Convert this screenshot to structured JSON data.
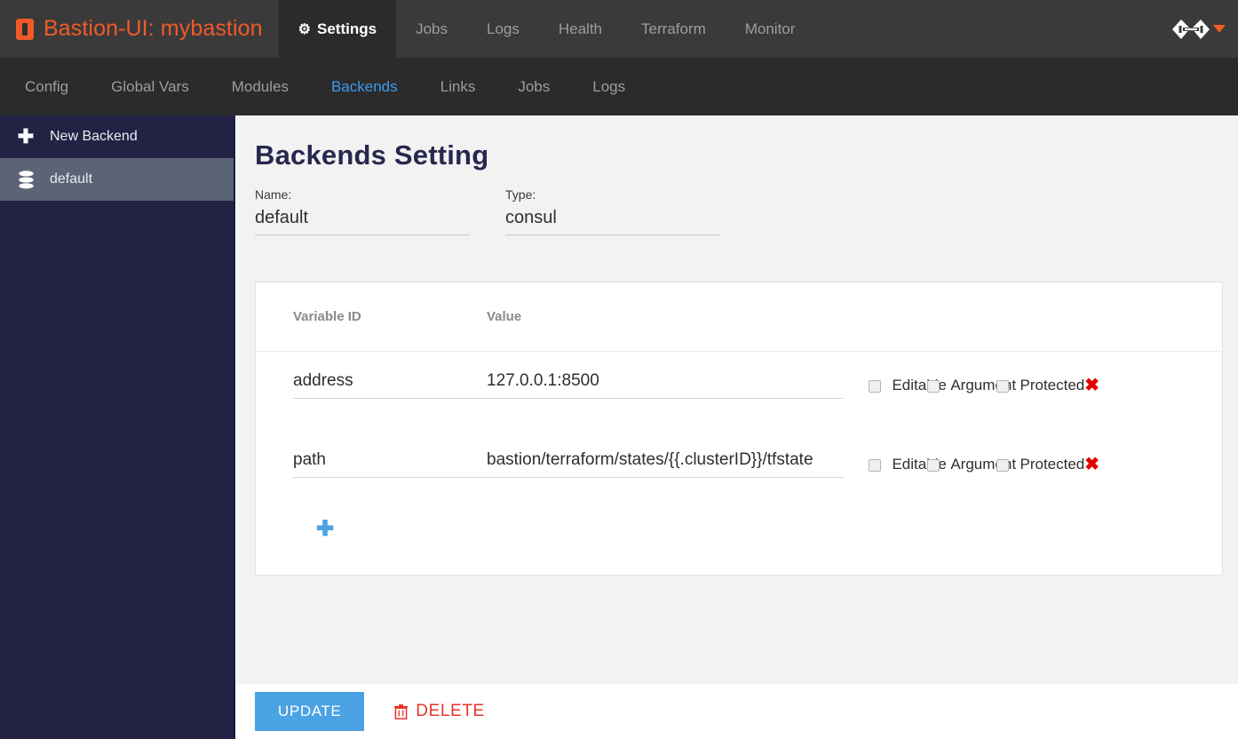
{
  "navbar": {
    "brand": "Bastion-UI: mybastion",
    "brand_icon": "bastion-logo-icon",
    "brand_color": "#f05a28",
    "tabs": [
      {
        "label": "Settings",
        "icon": "gear-icon",
        "active": true
      },
      {
        "label": "Jobs",
        "active": false
      },
      {
        "label": "Logs",
        "active": false
      },
      {
        "label": "Health",
        "active": false
      },
      {
        "label": "Terraform",
        "active": false
      },
      {
        "label": "Monitor",
        "active": false
      }
    ],
    "right": {
      "logo_icon": "git-chainlink-icon",
      "caret_icon": "caret-down-icon",
      "caret_color": "#f05a28"
    }
  },
  "subnav": {
    "items": [
      {
        "label": "Config",
        "active": false
      },
      {
        "label": "Global Vars",
        "active": false
      },
      {
        "label": "Modules",
        "active": false
      },
      {
        "label": "Backends",
        "active": true
      },
      {
        "label": "Links",
        "active": false
      },
      {
        "label": "Jobs",
        "active": false
      },
      {
        "label": "Logs",
        "active": false
      }
    ],
    "active_color": "#3a9bf0"
  },
  "sidebar": {
    "items": [
      {
        "label": "New Backend",
        "icon": "plus-icon",
        "selected": false
      },
      {
        "label": "default",
        "icon": "database-icon",
        "selected": true
      }
    ]
  },
  "main": {
    "title": "Backends Setting",
    "name_field": {
      "label": "Name:",
      "value": "default",
      "placeholder": "Name"
    },
    "type_field": {
      "label": "Type:",
      "value": "consul",
      "placeholder": "Type"
    },
    "table": {
      "headers": {
        "variable_id": "Variable ID",
        "value": "Value"
      },
      "rows": [
        {
          "variable_id": "address",
          "value": "127.0.0.1:8500",
          "editable_label": "Editable",
          "argument_label": "Argument",
          "protected_label": "Protected",
          "editable_checked": false,
          "argument_checked": false,
          "protected_checked": false,
          "delete_icon": "remove-row-icon"
        },
        {
          "variable_id": "path",
          "value": "bastion/terraform/states/{{.clusterID}}/tfstate",
          "editable_label": "Editable",
          "argument_label": "Argument",
          "protected_label": "Protected",
          "editable_checked": false,
          "argument_checked": false,
          "protected_checked": false,
          "delete_icon": "remove-row-icon"
        }
      ],
      "add_row_icon": "plus-icon"
    }
  },
  "footer": {
    "update_label": "UPDATE",
    "update_color": "#4ba3e3",
    "delete_label": "DELETE",
    "delete_color": "#e8342a",
    "delete_icon": "trash-icon"
  }
}
